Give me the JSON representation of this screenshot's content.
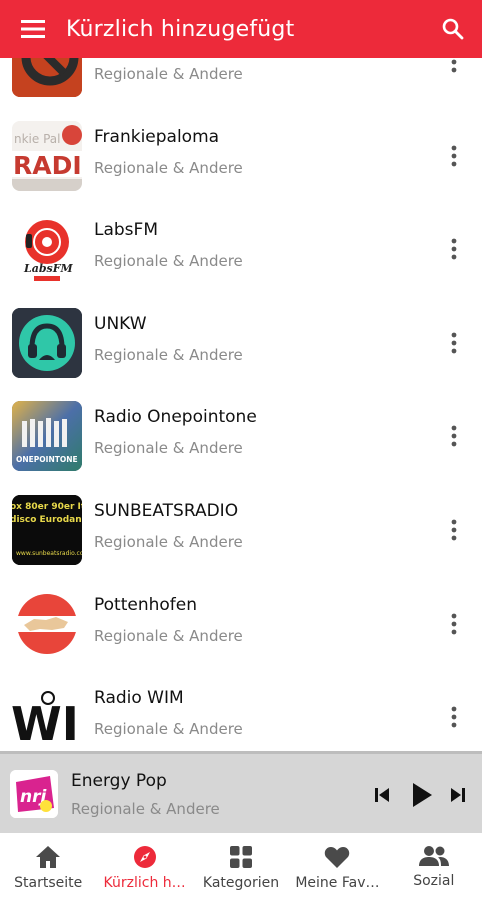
{
  "appbar": {
    "title": "Kürzlich hinzugefügt",
    "menu_icon": "menu-icon",
    "search_icon": "search-icon"
  },
  "stations": [
    {
      "name": "",
      "subtitle": "Regionale & Andere",
      "logo_icon": "partial-logo"
    },
    {
      "name": "Frankiepaloma",
      "subtitle": "Regionale & Andere",
      "logo_icon": "frankie-radio-logo",
      "logo_text": "RADIO"
    },
    {
      "name": "LabsFM",
      "subtitle": "Regionale & Andere",
      "logo_icon": "labsfm-logo"
    },
    {
      "name": "UNKW",
      "subtitle": "Regionale & Andere",
      "logo_icon": "headphones-logo"
    },
    {
      "name": "Radio Onepointone",
      "subtitle": "Regionale & Andere",
      "logo_icon": "onepointone-logo",
      "logo_text": "ONEPOINTONE"
    },
    {
      "name": "SUNBEATSRADIO",
      "subtitle": "Regionale & Andere",
      "logo_icon": "sunbeats-logo"
    },
    {
      "name": "Pottenhofen",
      "subtitle": "Regionale & Andere",
      "logo_icon": "austria-map-logo"
    },
    {
      "name": "Radio WIM",
      "subtitle": "Regionale & Andere",
      "logo_icon": "wim-logo",
      "logo_text": "WIM"
    }
  ],
  "player": {
    "title": "Energy Pop",
    "subtitle": "Regionale & Andere",
    "logo_icon": "nrj-logo",
    "logo_text": "nrj"
  },
  "nav": {
    "tabs": [
      {
        "label": "Startseite",
        "icon": "home-icon",
        "active": false
      },
      {
        "label": "Kürzlich h…",
        "icon": "compass-icon",
        "active": true
      },
      {
        "label": "Kategorien",
        "icon": "grid-icon",
        "active": false
      },
      {
        "label": "Meine Fav…",
        "icon": "heart-icon",
        "active": false
      },
      {
        "label": "Sozial",
        "icon": "people-icon",
        "active": false
      }
    ]
  },
  "colors": {
    "accent": "#ed2a3a",
    "player_bg": "#d6d6d6",
    "subtitle": "#8a8a8a"
  }
}
